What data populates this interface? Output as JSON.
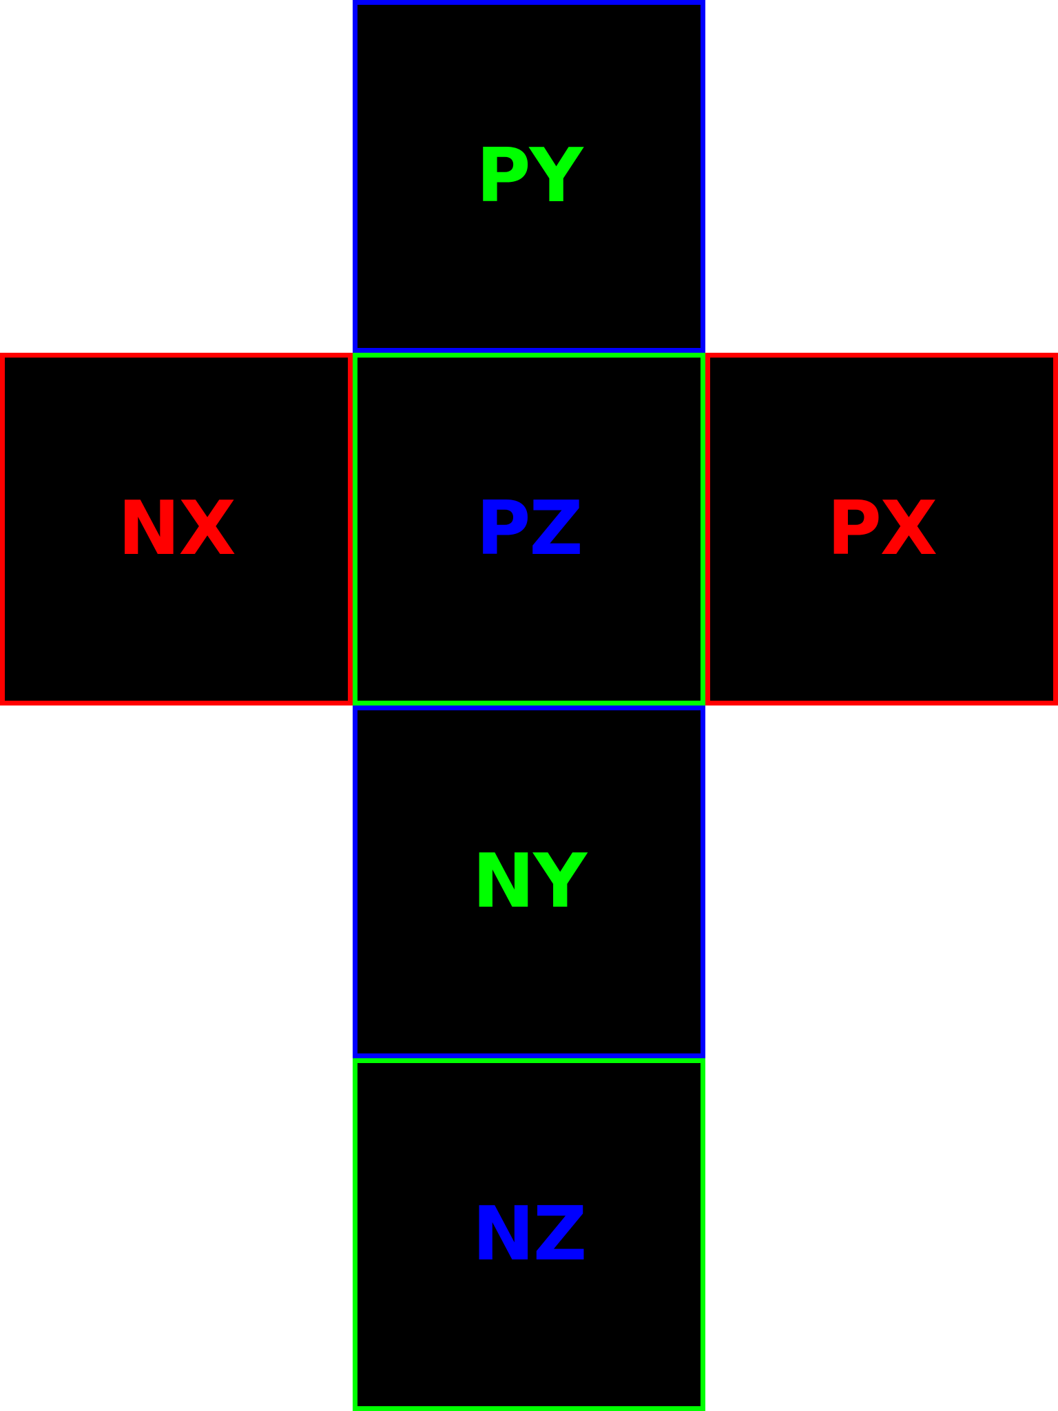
{
  "faces": {
    "py": {
      "label": "PY",
      "border_color": "#0000ff",
      "text_color": "#00ff00"
    },
    "nx": {
      "label": "NX",
      "border_color": "#ff0000",
      "text_color": "#ff0000"
    },
    "pz": {
      "label": "PZ",
      "border_color": "#00ff00",
      "text_color": "#0000ff"
    },
    "px": {
      "label": "PX",
      "border_color": "#ff0000",
      "text_color": "#ff0000"
    },
    "ny": {
      "label": "NY",
      "border_color": "#0000ff",
      "text_color": "#00ff00"
    },
    "nz": {
      "label": "NZ",
      "border_color": "#00ff00",
      "text_color": "#0000ff"
    }
  },
  "colors": {
    "background": "#ffffff",
    "face_fill": "#000000"
  }
}
